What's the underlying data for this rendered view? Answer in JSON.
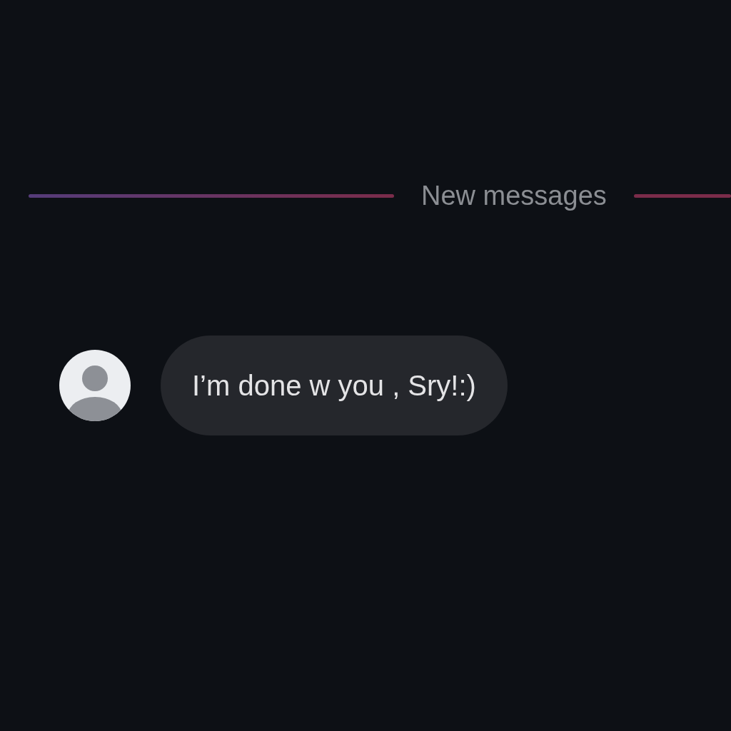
{
  "divider": {
    "label": "New messages"
  },
  "messages": [
    {
      "text": "I’m done w you , Sry!:)"
    }
  ]
}
